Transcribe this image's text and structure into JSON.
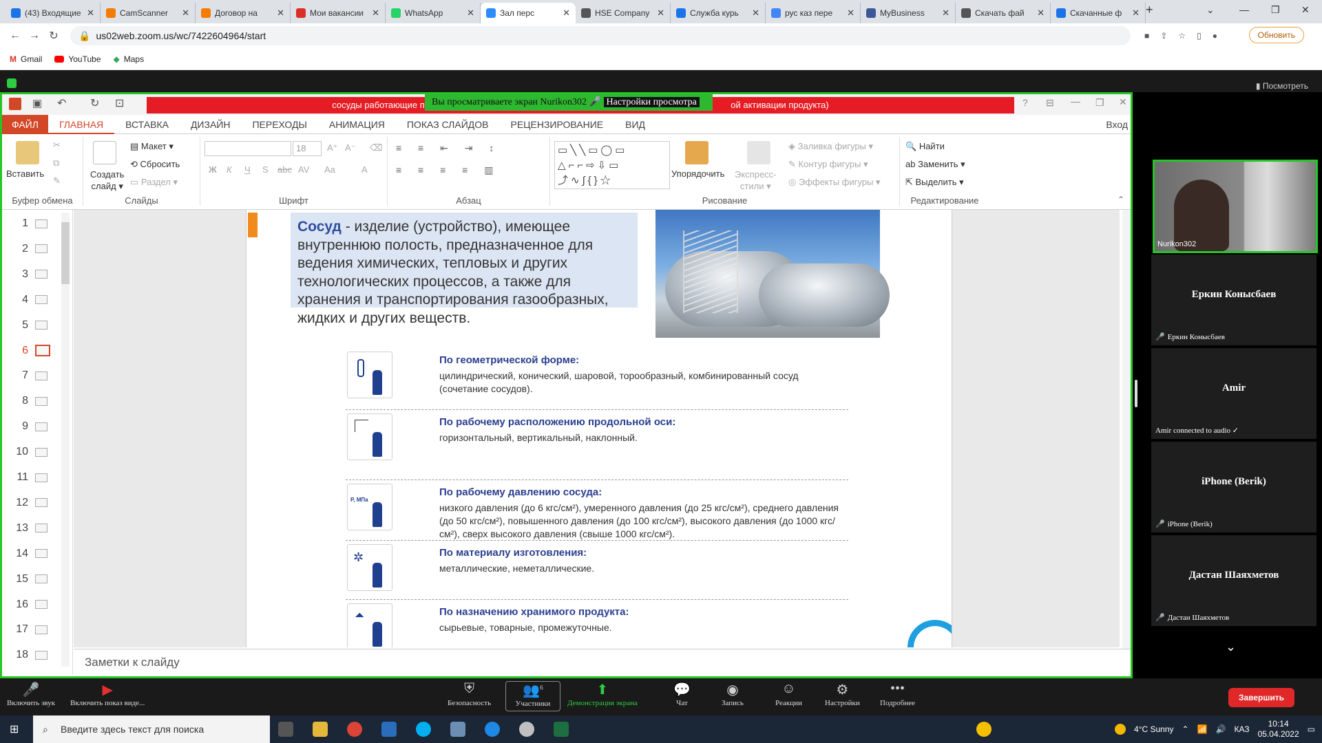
{
  "browser": {
    "tabs": [
      {
        "label": "(43) Входящие",
        "color": "#1a73e8"
      },
      {
        "label": "CamScanner",
        "color": "#f57c00"
      },
      {
        "label": "Договор на",
        "color": "#f57c00"
      },
      {
        "label": "Мои вакансии",
        "color": "#d93025"
      },
      {
        "label": "WhatsApp",
        "color": "#25d366"
      },
      {
        "label": "Зал перс",
        "color": "#2d8cff"
      },
      {
        "label": "HSE Company",
        "color": "#555"
      },
      {
        "label": "Служба курь",
        "color": "#1a73e8"
      },
      {
        "label": "рус каз пере",
        "color": "#4285f4"
      },
      {
        "label": "MyBusiness",
        "color": "#3b5998"
      },
      {
        "label": "Скачать фай",
        "color": "#555"
      },
      {
        "label": "Скачанные ф",
        "color": "#1a73e8"
      }
    ],
    "url": "us02web.zoom.us/wc/7422604964/start",
    "update_label": "Обновить",
    "bookmarks": [
      "Gmail",
      "YouTube",
      "Maps"
    ]
  },
  "zoom": {
    "view_label": "Посмотреть",
    "banner_text": "Вы просматриваете экран Nurikon302",
    "banner_settings": "Настройки просмотра",
    "red_bar_left": "сосуды работающие под",
    "red_bar_right": "ой активации продукта)"
  },
  "ppt": {
    "tabs": [
      "ФАЙЛ",
      "ГЛАВНАЯ",
      "ВСТАВКА",
      "ДИЗАЙН",
      "ПЕРЕХОДЫ",
      "АНИМАЦИЯ",
      "ПОКАЗ СЛАЙДОВ",
      "РЕЦЕНЗИРОВАНИЕ",
      "ВИД"
    ],
    "signin": "Вход",
    "groups": {
      "clipboard": "Буфер обмена",
      "slides": "Слайды",
      "font": "Шрифт",
      "paragraph": "Абзац",
      "drawing": "Рисование",
      "editing": "Редактирование"
    },
    "buttons": {
      "paste": "Вставить",
      "new_slide_1": "Создать",
      "new_slide_2": "слайд",
      "layout": "Макет",
      "reset": "Сбросить",
      "section": "Раздел",
      "font_size": "18",
      "arrange": "Упорядочить",
      "quick_styles_1": "Экспресс-",
      "quick_styles_2": "стили",
      "shape_fill": "Заливка фигуры",
      "shape_outline": "Контур фигуры",
      "shape_effects": "Эффекты фигуры",
      "find": "Найти",
      "replace": "Заменить",
      "select": "Выделить"
    },
    "font_buttons": [
      "Ж",
      "К",
      "Ч",
      "S",
      "abc",
      "AV",
      "Aa",
      "A"
    ],
    "slide_numbers": [
      "1",
      "2",
      "3",
      "4",
      "5",
      "6",
      "7",
      "8",
      "9",
      "10",
      "11",
      "12",
      "13",
      "14",
      "15",
      "16",
      "17",
      "18"
    ],
    "selected_slide": "6",
    "notes_placeholder": "Заметки к слайду"
  },
  "slide": {
    "term": "Сосуд",
    "definition": " - изделие (устройство), имеющее внутреннюю полость, предназначенное для ведения химических, тепловых и других технологических процессов, а также для хранения и транспортирования газообразных, жидких и других веществ.",
    "categories": [
      {
        "title": "По геометрической форме:",
        "text": "цилиндрический, конический, шаровой, торообразный, комбинированный сосуд (сочетание сосудов)."
      },
      {
        "title": "По рабочему расположению продольной оси:",
        "text": "горизонтальный, вертикальный, наклонный."
      },
      {
        "title": "По рабочему давлению сосуда:",
        "text": "низкого давления (до 6 кгс/см²), умеренного давления (до 25 кгс/см²), среднего давления (до 50 кгс/см²), повышенного давления (до 100 кгс/см²), высокого давления (до 1000 кгс/см²), сверх высокого давления (свыше 1000 кгс/см²).",
        "icon_label": "P, МПа"
      },
      {
        "title": "По материалу изготовления:",
        "text": "металлические, неметаллические."
      },
      {
        "title": "По назначению хранимого продукта:",
        "text": "сырьевые, товарные, промежуточные."
      }
    ]
  },
  "participants": [
    {
      "name": "Nurikon302"
    },
    {
      "name": "Еркин Конысбаев",
      "label": "Еркин Конысбаев"
    },
    {
      "name": "Amir",
      "label": "Amir connected to audio ✓"
    },
    {
      "name": "iPhone (Berik)",
      "label": "iPhone (Berik)"
    },
    {
      "name": "Дастан Шаяхметов",
      "label": "Дастан Шаяхметов"
    }
  ],
  "toolbar": {
    "unmute": "Включить звук",
    "start_video": "Включить показ виде...",
    "security": "Безопасность",
    "participants": "Участники",
    "participants_count": "6",
    "share": "Демонстрация экрана",
    "chat": "Чат",
    "record": "Запись",
    "reactions": "Реакции",
    "settings": "Настройки",
    "more": "Подробнее",
    "end": "Завершить"
  },
  "taskbar": {
    "search_placeholder": "Введите здесь текст для поиска",
    "weather": "4°C  Sunny",
    "lang": "КАЗ",
    "time": "10:14",
    "date": "05.04.2022"
  }
}
